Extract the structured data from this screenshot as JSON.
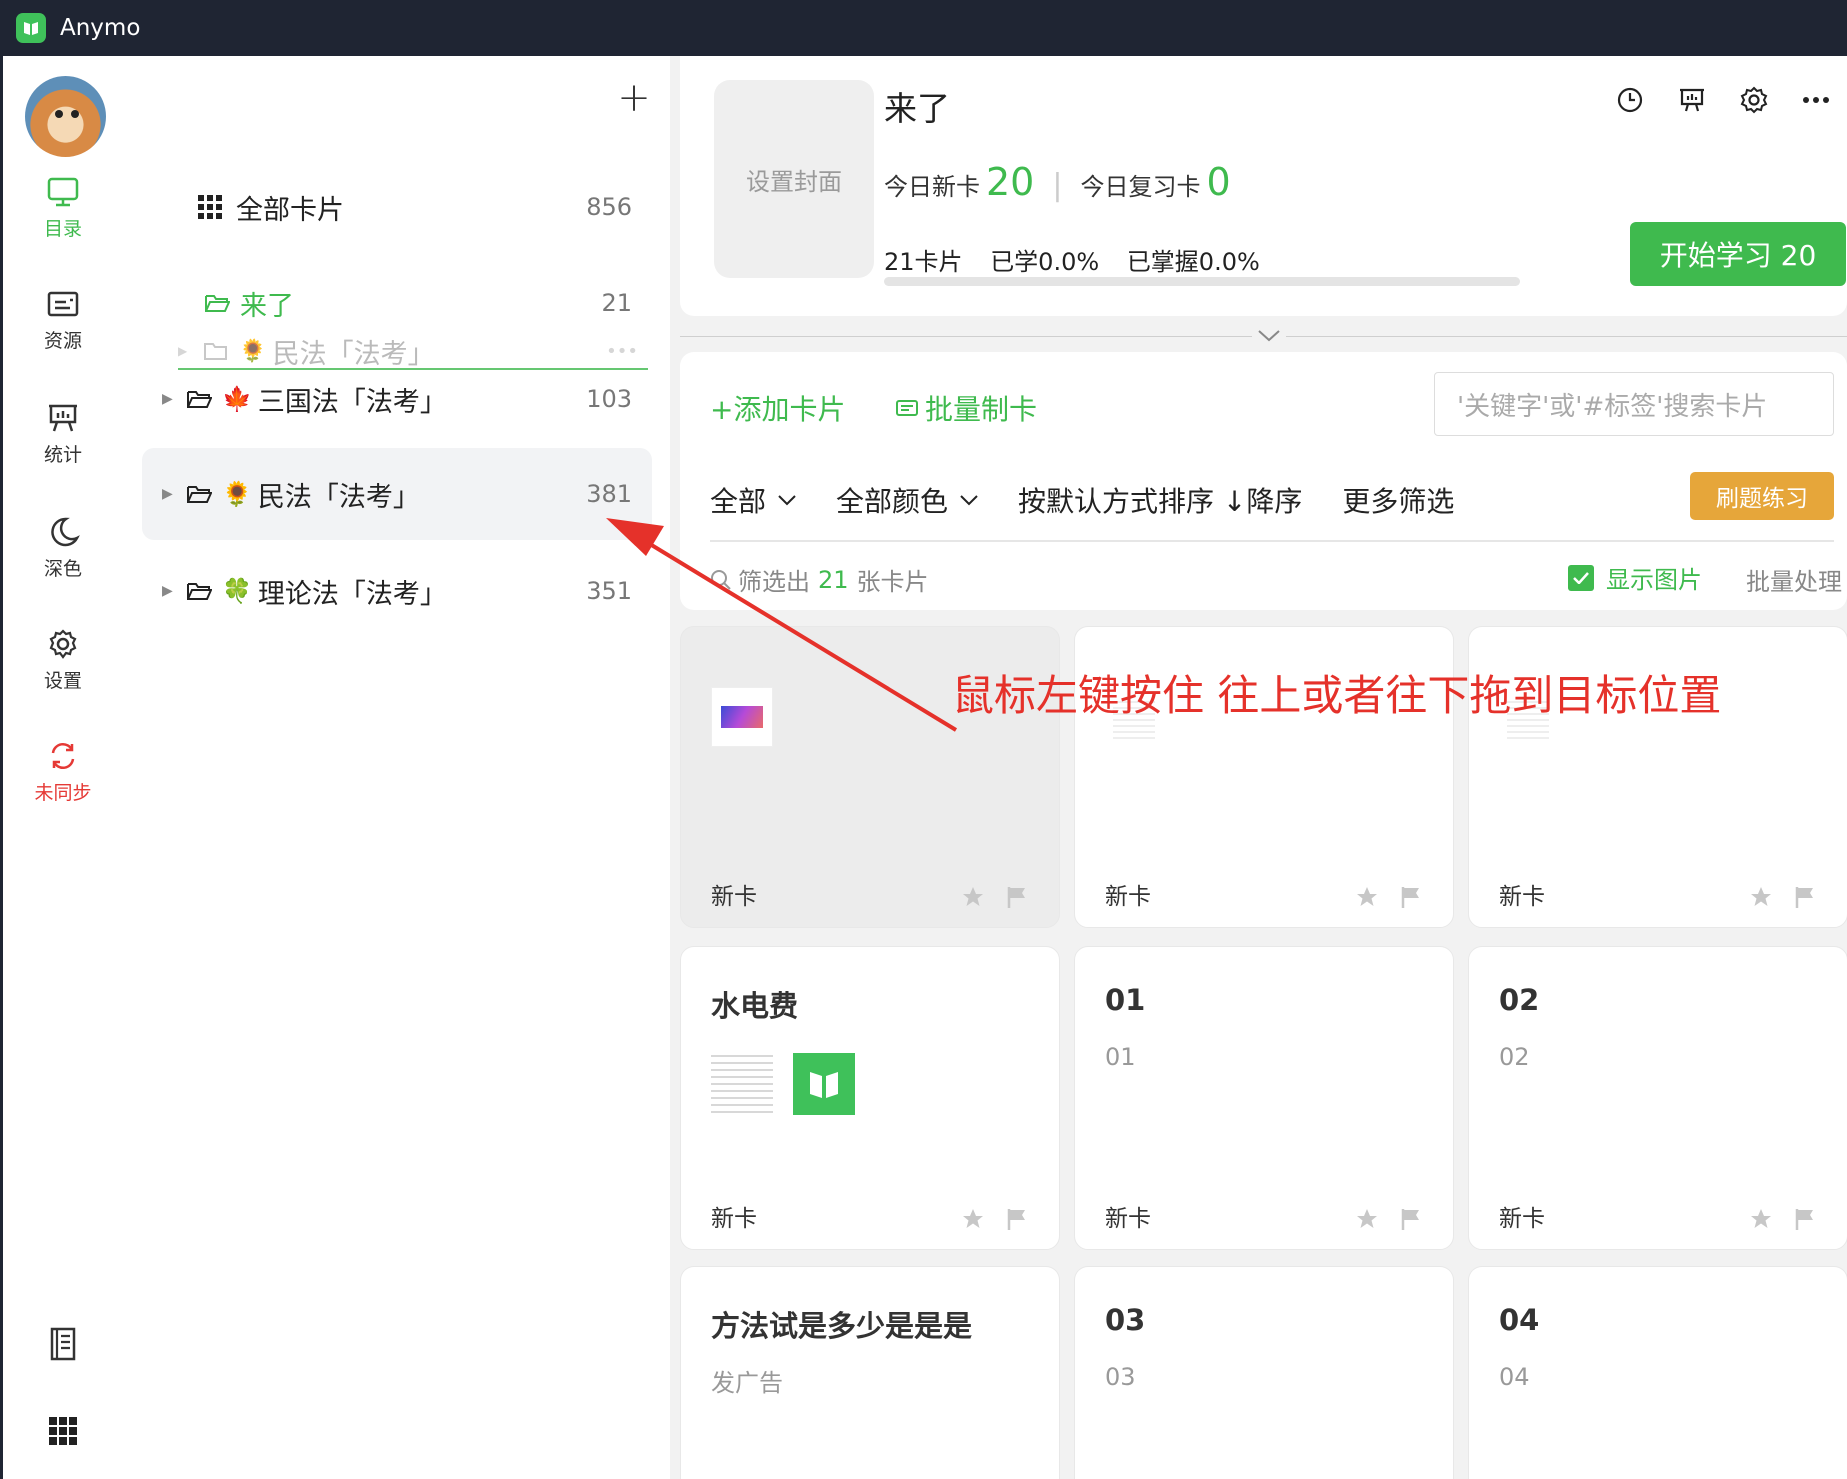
{
  "app": {
    "title": "Anymo"
  },
  "rail": {
    "items": [
      {
        "label": "目录"
      },
      {
        "label": "资源"
      },
      {
        "label": "统计"
      },
      {
        "label": "深色"
      },
      {
        "label": "设置"
      },
      {
        "label": "未同步"
      }
    ]
  },
  "folders": {
    "all_label": "全部卡片",
    "all_count": "856",
    "current": {
      "label": "来了",
      "count": "21"
    },
    "dragging": {
      "label": "民法「法考」",
      "emoji": "🌻"
    },
    "items": [
      {
        "emoji": "🍁",
        "label": "三国法「法考」",
        "count": "103"
      },
      {
        "emoji": "🌻",
        "label": "民法「法考」",
        "count": "381"
      },
      {
        "emoji": "🍀",
        "label": "理论法「法考」",
        "count": "351"
      }
    ]
  },
  "deck": {
    "cover_label": "设置封面",
    "title": "来了",
    "new_today_label": "今日新卡",
    "new_today": "20",
    "review_today_label": "今日复习卡",
    "review_today": "0",
    "cards_total": "21卡片",
    "learned": "已学0.0%",
    "mastered": "已掌握0.0%",
    "progress": 0,
    "start_label": "开始学习 20"
  },
  "list": {
    "add_label": "添加卡片",
    "batch_label": "批量制卡",
    "search_placeholder": "'关键字'或'#标签'搜索卡片",
    "filter_all": "全部",
    "filter_color": "全部颜色",
    "sort": "按默认方式排序 ↓降序",
    "more": "更多筛选",
    "practice_label": "刷题练习",
    "result_prefix": "筛选出",
    "result_count": "21",
    "result_suffix": "张卡片",
    "show_images": "显示图片",
    "batch_process": "批量处理"
  },
  "cards": [
    {
      "title": "",
      "sub": "",
      "foot": "新卡"
    },
    {
      "title": "",
      "sub": "",
      "foot": "新卡"
    },
    {
      "title": "",
      "sub": "",
      "foot": "新卡"
    },
    {
      "title": "水电费",
      "sub": "",
      "foot": "新卡"
    },
    {
      "title": "01",
      "sub": "01",
      "foot": "新卡"
    },
    {
      "title": "02",
      "sub": "02",
      "foot": "新卡"
    },
    {
      "title": "方法试是多少是是是",
      "sub": "发广告"
    },
    {
      "title": "03",
      "sub": "03"
    },
    {
      "title": "04",
      "sub": "04"
    }
  ],
  "annotation": {
    "text": "鼠标左键按住 往上或者往下拖到目标位置",
    "color": "#e5312a"
  },
  "colors": {
    "accent": "#3fba4e",
    "warn": "#e53935",
    "practice": "#e6a63a",
    "titlebar": "#1f2533"
  }
}
